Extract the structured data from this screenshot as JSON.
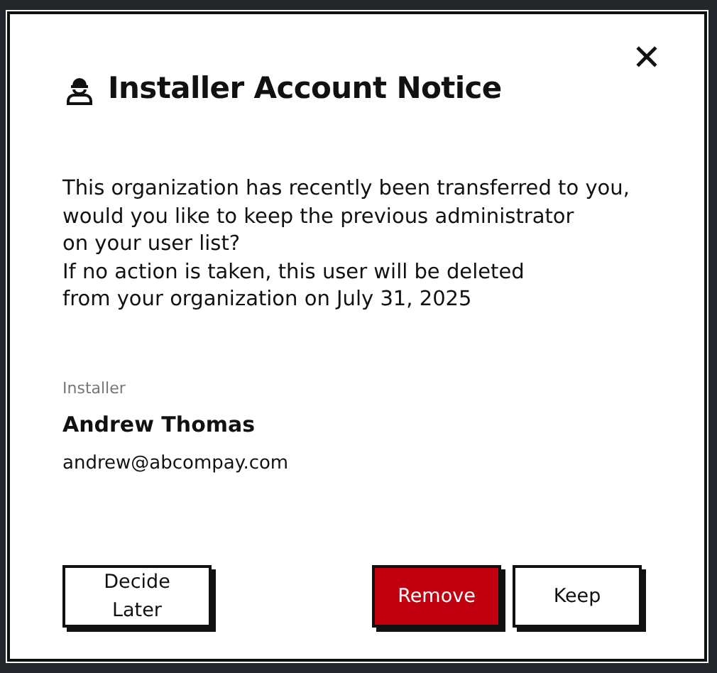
{
  "dialog": {
    "title": "Installer Account Notice",
    "close_symbol": "✕",
    "message_lines": [
      "This organization has recently been transferred to you,",
      "would you like to keep the previous administrator",
      "on your user list?",
      "If no action is taken, this user will be deleted",
      "from your organization on July 31, 2025"
    ],
    "user": {
      "role": "Installer",
      "name": "Andrew Thomas",
      "email": "andrew@abcompay.com"
    },
    "buttons": [
      {
        "label": "Decide Later",
        "kind": "secondary"
      },
      {
        "label": "Remove",
        "kind": "danger"
      },
      {
        "label": "Keep",
        "kind": "secondary"
      }
    ]
  }
}
